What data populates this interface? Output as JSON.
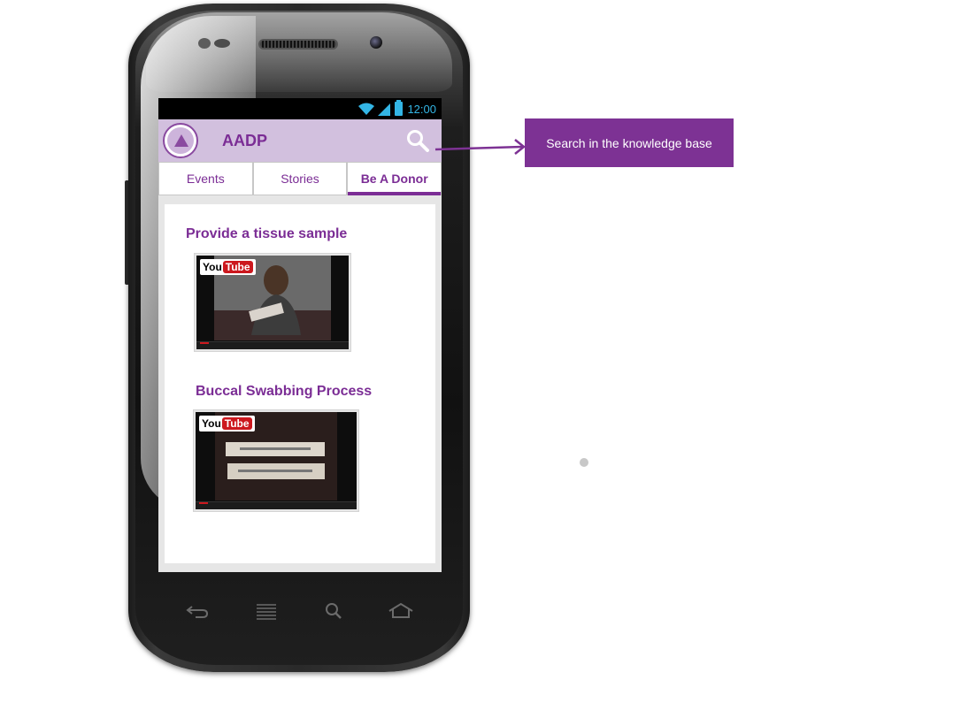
{
  "status_bar": {
    "time": "12:00"
  },
  "app_bar": {
    "title": "AADP",
    "search_icon": "search-icon",
    "logo_icon": "aadp-logo"
  },
  "tabs": [
    {
      "label": "Events",
      "active": false
    },
    {
      "label": "Stories",
      "active": false
    },
    {
      "label": "Be A Donor",
      "active": true
    }
  ],
  "videos": [
    {
      "title": "Provide a tissue sample",
      "badge_you": "You",
      "badge_tube": "Tube"
    },
    {
      "title": "Buccal Swabbing Process",
      "badge_you": "You",
      "badge_tube": "Tube"
    }
  ],
  "callout": {
    "text": "Search in the knowledge base"
  },
  "nav_keys": [
    "back-icon",
    "menu-icon",
    "search-icon",
    "home-icon"
  ],
  "colors": {
    "accent": "#7b2d95",
    "appbar": "#d2c0de",
    "callout": "#7d3294",
    "status_accent": "#33b5e5"
  }
}
